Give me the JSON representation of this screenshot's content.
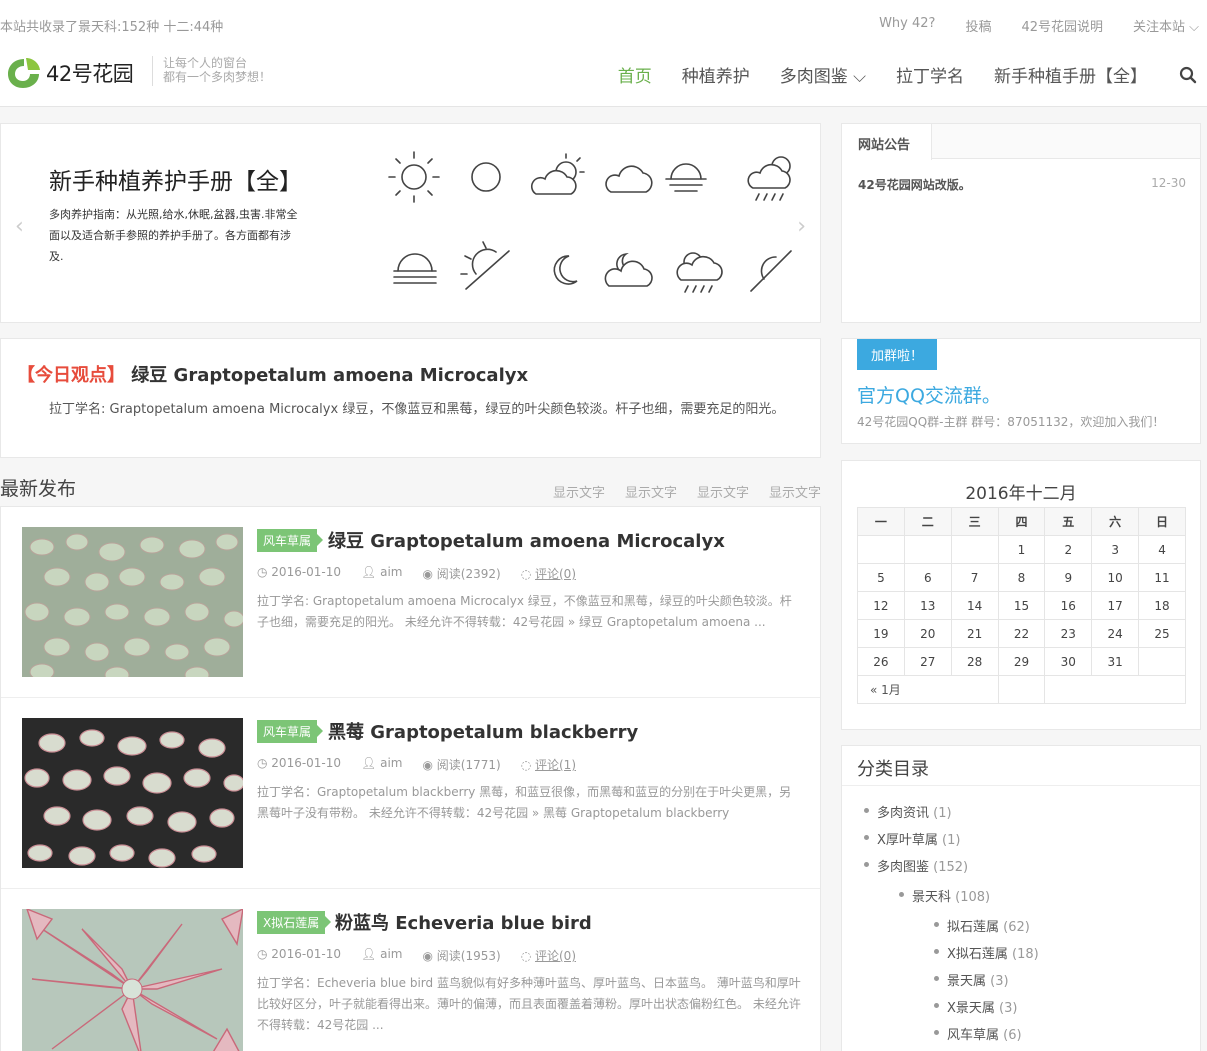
{
  "topbar": {
    "stats": "本站共收录了景天科:152种 十二:44种",
    "links": [
      "Why 42?",
      "投稿",
      "42号花园说明",
      "关注本站 ⌵"
    ]
  },
  "header": {
    "logo_text": "42号花园",
    "tagline_1": "让每个人的窗台",
    "tagline_2": "都有一个多肉梦想！",
    "nav": [
      "首页",
      "种植养护",
      "多肉图鉴 ⌵",
      "拉丁学名",
      "新手种植手册【全】"
    ]
  },
  "slider": {
    "title": "新手种植养护手册【全】",
    "desc": "多肉养护指南：从光照,给水,休眠,盆器,虫害.非常全面以及适合新手参照的养护手册了。各方面都有涉及."
  },
  "today": {
    "tag": "【今日观点】",
    "title": "绿豆 Graptopetalum amoena Microcalyx",
    "text": "拉丁学名: Graptopetalum amoena Microcalyx 绿豆，不像蓝豆和黑莓，绿豆的叶尖颜色较淡。杆子也细，需要充足的阳光。"
  },
  "latest": {
    "title": "最新发布",
    "tabs": [
      "显示文字",
      "显示文字",
      "显示文字",
      "显示文字"
    ]
  },
  "posts": [
    {
      "cat": "风车草属",
      "title": "绿豆 Graptopetalum amoena Microcalyx",
      "date": "2016-01-10",
      "author": "aim",
      "views": "阅读(2392)",
      "comments": "评论(0)",
      "excerpt": "拉丁学名: Graptopetalum amoena Microcalyx 绿豆，不像蓝豆和黑莓，绿豆的叶尖颜色较淡。杆子也细，需要充足的阳光。 未经允许不得转载：42号花园 » 绿豆 Graptopetalum amoena ..."
    },
    {
      "cat": "风车草属",
      "title": "黑莓 Graptopetalum blackberry",
      "date": "2016-01-10",
      "author": "aim",
      "views": "阅读(1771)",
      "comments": "评论(1)",
      "excerpt": "拉丁学名：Graptopetalum blackberry 黑莓，和蓝豆很像，而黑莓和蓝豆的分别在于叶尖更黑，另黑莓叶子没有带粉。 未经允许不得转载：42号花园 » 黑莓 Graptopetalum blackberry"
    },
    {
      "cat": "X拟石莲属",
      "title": "粉蓝鸟 Echeveria blue bird",
      "date": "2016-01-10",
      "author": "aim",
      "views": "阅读(1953)",
      "comments": "评论(0)",
      "excerpt": "拉丁学名：Echeveria blue bird 蓝鸟貌似有好多种薄叶蓝鸟、厚叶蓝鸟、日本蓝鸟。 薄叶蓝鸟和厚叶比较好区分，叶子就能看得出来。薄叶的偏薄，而且表面覆盖着薄粉。厚叶出状态偏粉红色。 未经允许不得转载：42号花园 ..."
    }
  ],
  "notice": {
    "tab": "网站公告",
    "item_title": "42号花园网站改版。",
    "item_date": "12-30"
  },
  "qq": {
    "badge": "加群啦！",
    "title": "官方QQ交流群。",
    "text": "42号花园QQ群-主群 群号：87051132，欢迎加入我们！"
  },
  "calendar": {
    "caption": "2016年十二月",
    "weekdays": [
      "一",
      "二",
      "三",
      "四",
      "五",
      "六",
      "日"
    ],
    "weeks": [
      [
        "",
        "",
        "",
        "1",
        "2",
        "3",
        "4"
      ],
      [
        "5",
        "6",
        "7",
        "8",
        "9",
        "10",
        "11"
      ],
      [
        "12",
        "13",
        "14",
        "15",
        "16",
        "17",
        "18"
      ],
      [
        "19",
        "20",
        "21",
        "22",
        "23",
        "24",
        "25"
      ],
      [
        "26",
        "27",
        "28",
        "29",
        "30",
        "31",
        ""
      ]
    ],
    "prev": "« 1月"
  },
  "categories": {
    "title": "分类目录",
    "items": [
      {
        "name": "多肉资讯",
        "count": "(1)"
      },
      {
        "name": "X厚叶草属",
        "count": "(1)"
      },
      {
        "name": "多肉图鉴",
        "count": "(152)"
      },
      {
        "name": "景天科",
        "count": "(108)"
      },
      {
        "name": "拟石莲属",
        "count": "(62)"
      },
      {
        "name": "X拟石莲属",
        "count": "(18)"
      },
      {
        "name": "景天属",
        "count": "(3)"
      },
      {
        "name": "X景天属",
        "count": "(3)"
      },
      {
        "name": "风车草属",
        "count": "(6)"
      }
    ]
  },
  "colors": {
    "accent": "#6ab04c",
    "tag_red": "#e74c3c",
    "qq_blue": "#3ca9e0",
    "category_green": "#7cc576"
  }
}
